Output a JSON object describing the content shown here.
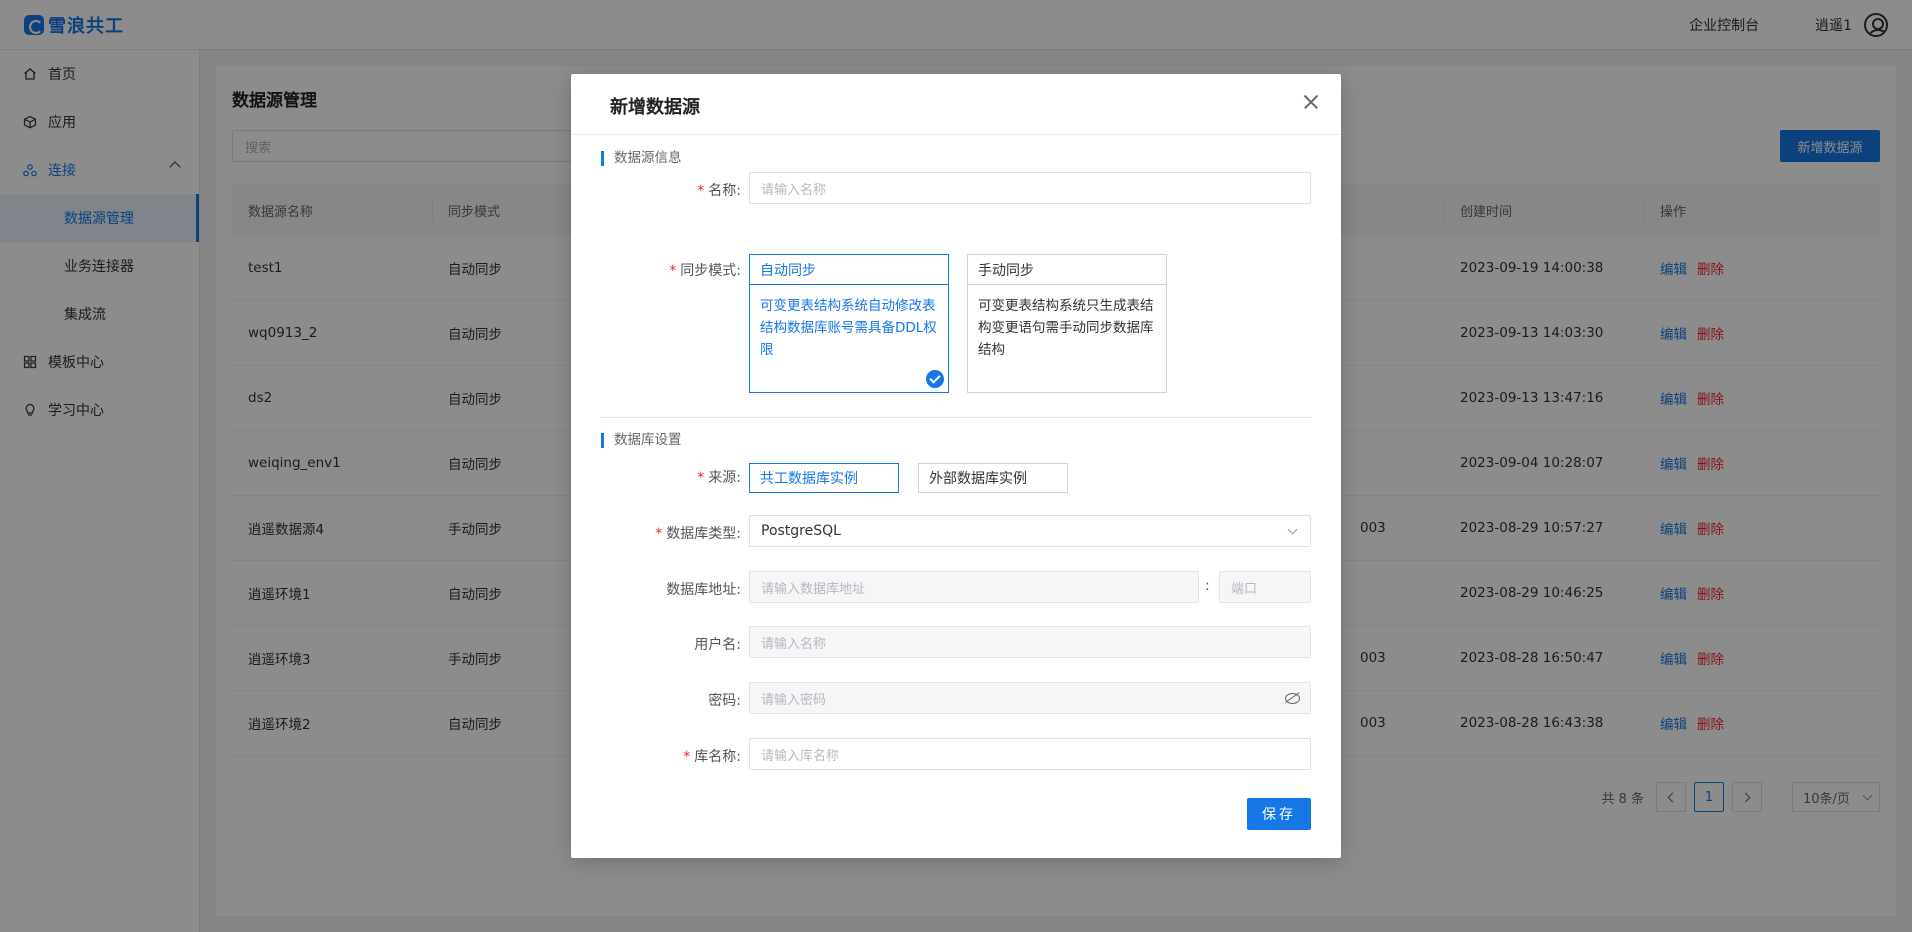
{
  "header": {
    "brand": "雪浪共工",
    "console": "企业控制台",
    "user": "逍遥1"
  },
  "sidebar": {
    "items": [
      {
        "label": "首页",
        "icon": "home-icon"
      },
      {
        "label": "应用",
        "icon": "cube-icon"
      },
      {
        "label": "连接",
        "icon": "connect-icon"
      },
      {
        "label": "模板中心",
        "icon": "grid-icon"
      },
      {
        "label": "学习中心",
        "icon": "bulb-icon"
      }
    ],
    "sub_items": [
      {
        "label": "数据源管理",
        "active": true
      },
      {
        "label": "业务连接器",
        "active": false
      },
      {
        "label": "集成流",
        "active": false
      }
    ]
  },
  "page": {
    "title": "数据源管理",
    "search_placeholder": "搜索",
    "add_button": "新增数据源"
  },
  "table": {
    "headers": [
      "数据源名称",
      "同步模式",
      "创建时间",
      "操作"
    ],
    "rows": [
      {
        "name": "test1",
        "mode": "自动同步",
        "extra": "",
        "time": "2023-09-19 14:00:38"
      },
      {
        "name": "wq0913_2",
        "mode": "自动同步",
        "extra": "",
        "time": "2023-09-13 14:03:30"
      },
      {
        "name": "ds2",
        "mode": "自动同步",
        "extra": "",
        "time": "2023-09-13 13:47:16"
      },
      {
        "name": "weiqing_env1",
        "mode": "自动同步",
        "extra": "",
        "time": "2023-09-04 10:28:07"
      },
      {
        "name": "逍遥数据源4",
        "mode": "手动同步",
        "extra": "003",
        "time": "2023-08-29 10:57:27"
      },
      {
        "name": "逍遥环境1",
        "mode": "自动同步",
        "extra": "",
        "time": "2023-08-29 10:46:25"
      },
      {
        "name": "逍遥环境3",
        "mode": "手动同步",
        "extra": "003",
        "time": "2023-08-28 16:50:47"
      },
      {
        "name": "逍遥环境2",
        "mode": "自动同步",
        "extra": "003",
        "time": "2023-08-28 16:43:38"
      }
    ],
    "op_edit": "编辑",
    "op_delete": "删除"
  },
  "pagination": {
    "total": "共 8 条",
    "current": "1",
    "page_size": "10条/页"
  },
  "modal": {
    "title": "新增数据源",
    "section_info": "数据源信息",
    "name_label": "名称:",
    "name_placeholder": "请输入名称",
    "sync_label": "同步模式:",
    "sync_auto": {
      "title": "自动同步",
      "desc": "可变更表结构系统自动修改表结构数据库账号需具备DDL权限"
    },
    "sync_manual": {
      "title": "手动同步",
      "desc": "可变更表结构系统只生成表结构变更语句需手动同步数据库结构"
    },
    "section_db": "数据库设置",
    "source_label": "来源:",
    "source_shared": "共工数据库实例",
    "source_external": "外部数据库实例",
    "dbtype_label": "数据库类型:",
    "dbtype_value": "PostgreSQL",
    "addr_label": "数据库地址:",
    "addr_placeholder": "请输入数据库地址",
    "port_sep": ":",
    "port_placeholder": "端口",
    "user_label": "用户名:",
    "user_placeholder": "请输入名称",
    "pwd_label": "密码:",
    "pwd_placeholder": "请输入密码",
    "dbname_label": "库名称:",
    "dbname_placeholder": "请输入库名称",
    "save": "保存",
    "required_mark": "*"
  },
  "colors": {
    "primary": "#1677e6",
    "danger": "#f5222d"
  }
}
